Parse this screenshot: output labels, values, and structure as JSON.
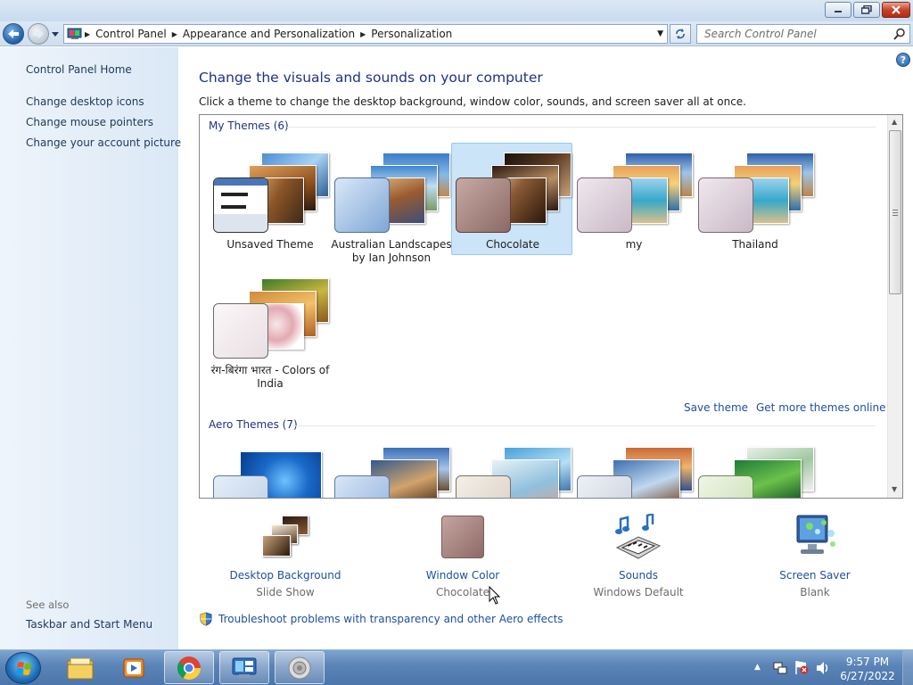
{
  "window": {
    "minimize_glyph": "▁",
    "maximize_glyph": "❐",
    "close_glyph": "✕"
  },
  "address_bar": {
    "crumbs": [
      "Control Panel",
      "Appearance and Personalization",
      "Personalization"
    ]
  },
  "search": {
    "placeholder": "Search Control Panel"
  },
  "left_pane": {
    "home_link": "Control Panel Home",
    "links": [
      "Change desktop icons",
      "Change mouse pointers",
      "Change your account picture"
    ],
    "see_also_label": "See also",
    "see_also_links": [
      "Taskbar and Start Menu"
    ]
  },
  "main": {
    "title": "Change the visuals and sounds on your computer",
    "subtitle": "Click a theme to change the desktop background, window color, sounds, and screen saver all at once.",
    "help_glyph": "?",
    "my_themes": {
      "header": "My Themes (6)",
      "items": [
        {
          "name": "Unsaved Theme",
          "selected": false
        },
        {
          "name": "Australian Landscapes by Ian Johnson",
          "selected": false
        },
        {
          "name": "Chocolate",
          "selected": true
        },
        {
          "name": "my",
          "selected": false
        },
        {
          "name": "Thailand",
          "selected": false
        },
        {
          "name": "रंग-बिरंगा भारत - Colors of India",
          "selected": false
        }
      ]
    },
    "save_theme_link": "Save theme",
    "get_more_link": "Get more themes online",
    "aero_themes": {
      "header": "Aero Themes (7)"
    }
  },
  "settings": [
    {
      "label": "Desktop Background",
      "value": "Slide Show"
    },
    {
      "label": "Window Color",
      "value": "Chocolate"
    },
    {
      "label": "Sounds",
      "value": "Windows Default"
    },
    {
      "label": "Screen Saver",
      "value": "Blank"
    }
  ],
  "troubleshoot_link": "Troubleshoot problems with transparency and other Aero effects",
  "taskbar": {
    "clock_time": "9:57 PM",
    "clock_date": "6/27/2022",
    "tray_arrow": "▲"
  },
  "colors": {
    "link": "#1e50a0",
    "heading": "#1e3287",
    "selection": "#cce4f7"
  }
}
